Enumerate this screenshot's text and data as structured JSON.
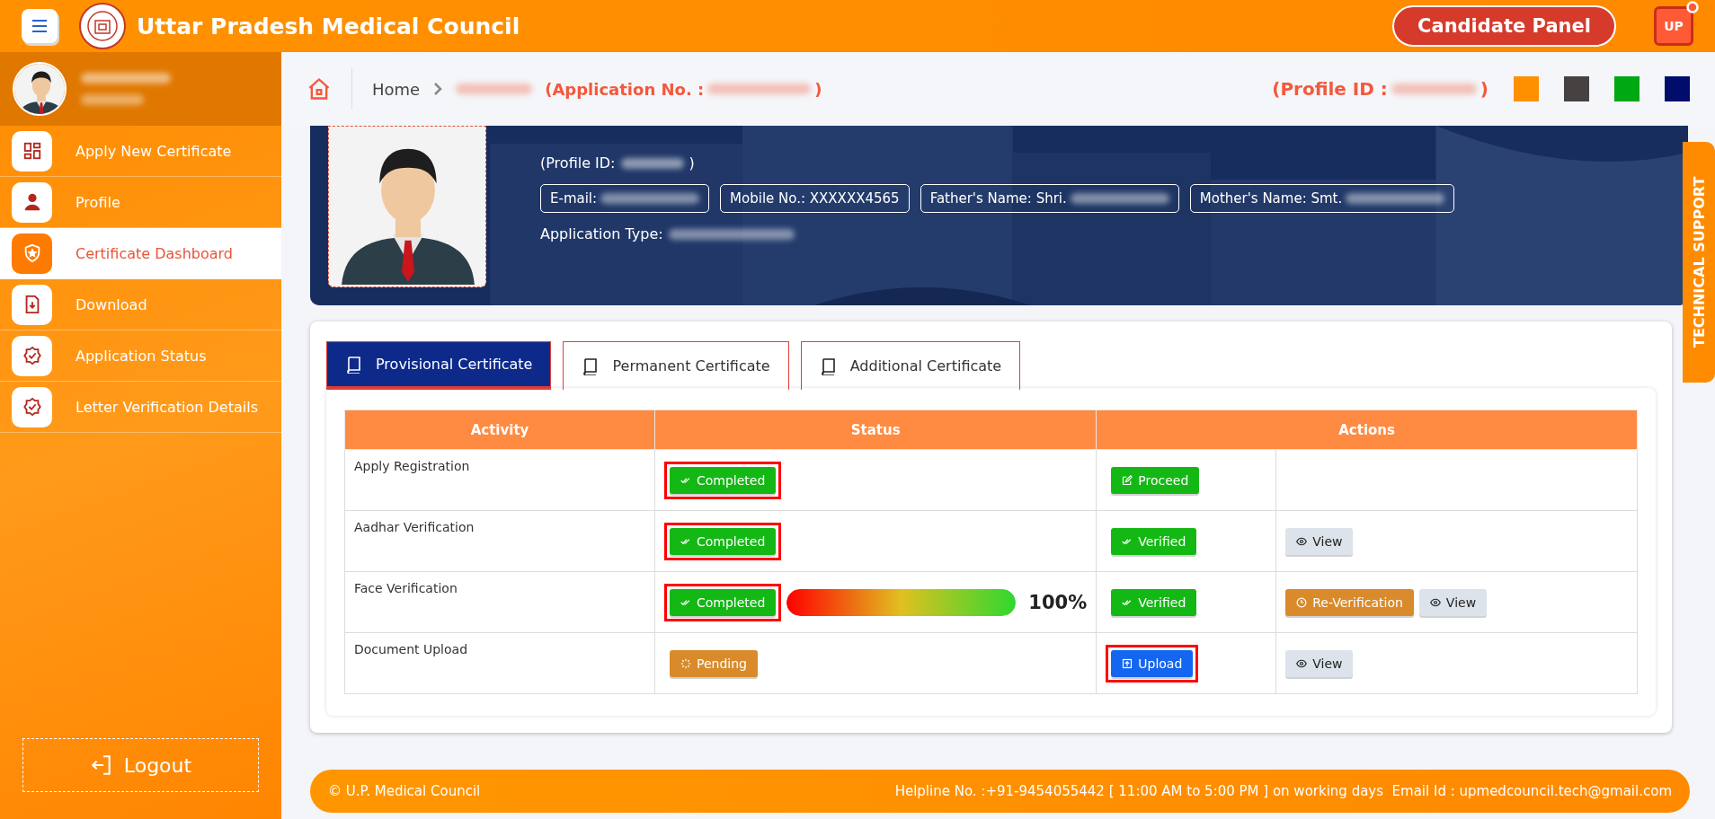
{
  "header": {
    "title": "Uttar Pradesh Medical Council",
    "panel_button": "Candidate Panel",
    "user_badge": "UP"
  },
  "sidebar": {
    "items": [
      {
        "label": "Apply New Certificate",
        "selected": false
      },
      {
        "label": "Profile",
        "selected": false
      },
      {
        "label": "Certificate Dashboard",
        "selected": true
      },
      {
        "label": "Download",
        "selected": false
      },
      {
        "label": "Application Status",
        "selected": false
      },
      {
        "label": "Letter Verification Details",
        "selected": false
      }
    ],
    "logout": "Logout"
  },
  "breadcrumb": {
    "home": "Home",
    "application_open": "(Application No. :",
    "application_close": ")",
    "profile_open": "(Profile ID :",
    "profile_close": ")",
    "theme_swatches": [
      {
        "color": "#ff9000"
      },
      {
        "color": "#464241"
      },
      {
        "color": "#00a813"
      },
      {
        "color": "#000d6b"
      }
    ]
  },
  "banner": {
    "profile_id": "(Profile ID:",
    "profile_id_close": ")",
    "chips": [
      {
        "label": "E-mail:",
        "redacted": true
      },
      {
        "label": "Mobile No.: XXXXXX4565",
        "redacted": false
      },
      {
        "label": "Father's Name: Shri.",
        "redacted": true
      },
      {
        "label": "Mother's Name: Smt.",
        "redacted": true
      }
    ],
    "application_type": "Application Type:"
  },
  "tabs": [
    {
      "label": "Provisional Certificate",
      "selected": true
    },
    {
      "label": "Permanent Certificate",
      "selected": false
    },
    {
      "label": "Additional Certificate",
      "selected": false
    }
  ],
  "table": {
    "columns": [
      "Activity",
      "Status",
      "Actions"
    ],
    "rows": [
      {
        "activity": "Apply Registration",
        "status": {
          "label": "Completed",
          "kind": "completed",
          "highlighted": true
        },
        "action": {
          "label": "Proceed",
          "kind": "proceed",
          "highlighted": false
        },
        "extra": []
      },
      {
        "activity": "Aadhar Verification",
        "status": {
          "label": "Completed",
          "kind": "completed",
          "highlighted": true
        },
        "action": {
          "label": "Verified",
          "kind": "verified",
          "highlighted": false
        },
        "extra": [
          {
            "label": "View",
            "kind": "view"
          }
        ]
      },
      {
        "activity": "Face Verification",
        "status": {
          "label": "Completed",
          "kind": "completed",
          "highlighted": true
        },
        "progress": {
          "level": 1,
          "reading": "100%"
        },
        "action": {
          "label": "Verified",
          "kind": "verified",
          "highlighted": false
        },
        "extra": [
          {
            "label": "Re-Verification",
            "kind": "reverify"
          },
          {
            "label": "View",
            "kind": "view"
          }
        ]
      },
      {
        "activity": "Document Upload",
        "status": {
          "label": "Pending",
          "kind": "pending",
          "highlighted": false
        },
        "action": {
          "label": "Upload",
          "kind": "upload",
          "highlighted": true
        },
        "extra": [
          {
            "label": "View",
            "kind": "view"
          }
        ]
      }
    ]
  },
  "footer": {
    "copyright": "© U.P. Medical Council",
    "helpline": "Helpline No. :+91-9454055442 [ 11:00 AM to 5:00 PM ] on working days  Email Id : upmedcouncil.tech@gmail.com"
  },
  "technical_support": "TECHNICAL SUPPORT"
}
